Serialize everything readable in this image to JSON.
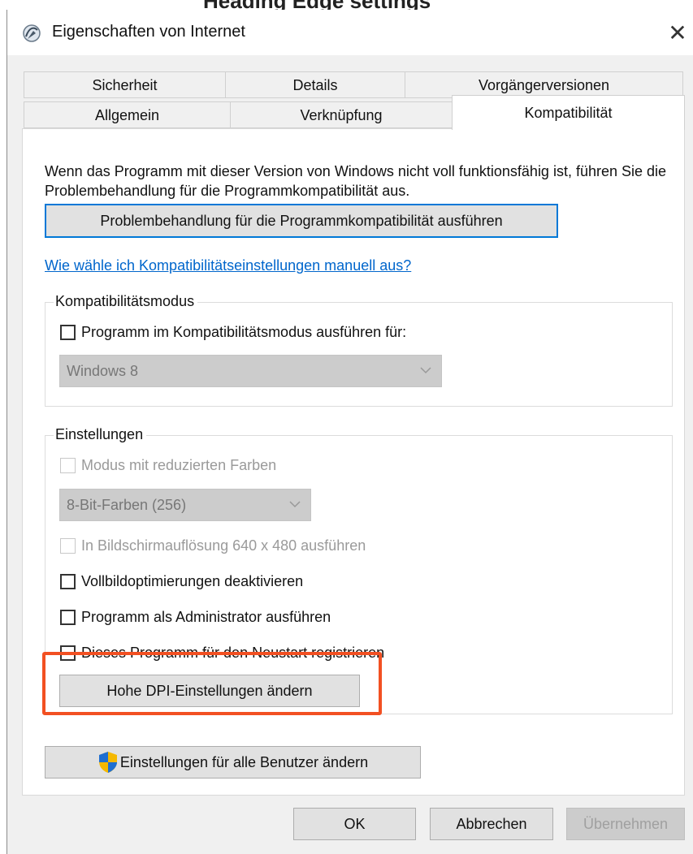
{
  "window": {
    "title": "Eigenschaften von Internet",
    "top_banner": "Heading Edge settings",
    "close_symbol": "✕",
    "icon": "internet-properties-icon"
  },
  "tabs": {
    "row1": [
      {
        "label": "Sicherheit"
      },
      {
        "label": "Details"
      },
      {
        "label": "Vorgängerversionen"
      }
    ],
    "row2": [
      {
        "label": "Allgemein"
      },
      {
        "label": "Verknüpfung"
      },
      {
        "label": "Kompatibilität",
        "active": true
      }
    ]
  },
  "compat": {
    "intro": "Wenn das Programm mit dieser Version von Windows nicht voll funktionsfähig ist, führen Sie die Problembehandlung für die Programmkompatibilität aus.",
    "troubleshoot_button": "Problembehandlung für die Programmkompatibilität ausführen",
    "help_link": "Wie wähle ich Kompatibilitätseinstellungen manuell aus?",
    "mode_group": {
      "title": "Kompatibilitätsmodus",
      "checkbox_label": "Programm im Kompatibilitätsmodus ausführen für:",
      "checked": false,
      "select_value": "Windows 8"
    },
    "settings_group": {
      "title": "Einstellungen",
      "reduced_color_label": "Modus mit reduzierten Farben",
      "color_select_value": "8-Bit-Farben (256)",
      "resolution_label": "In Bildschirmauflösung 640 x 480 ausführen",
      "fullscreen_opt_label": "Vollbildoptimierungen deaktivieren",
      "admin_label": "Programm als Administrator ausführen",
      "restart_label": "Dieses Programm für den Neustart registrieren",
      "dpi_button": "Hohe DPI-Einstellungen ändern"
    },
    "all_users_button": "Einstellungen für alle Benutzer ändern"
  },
  "footer": {
    "ok": "OK",
    "cancel": "Abbrechen",
    "apply": "Übernehmen"
  },
  "colors": {
    "highlight": "#f25022",
    "link": "#0066cc",
    "focus": "#0078d7"
  }
}
